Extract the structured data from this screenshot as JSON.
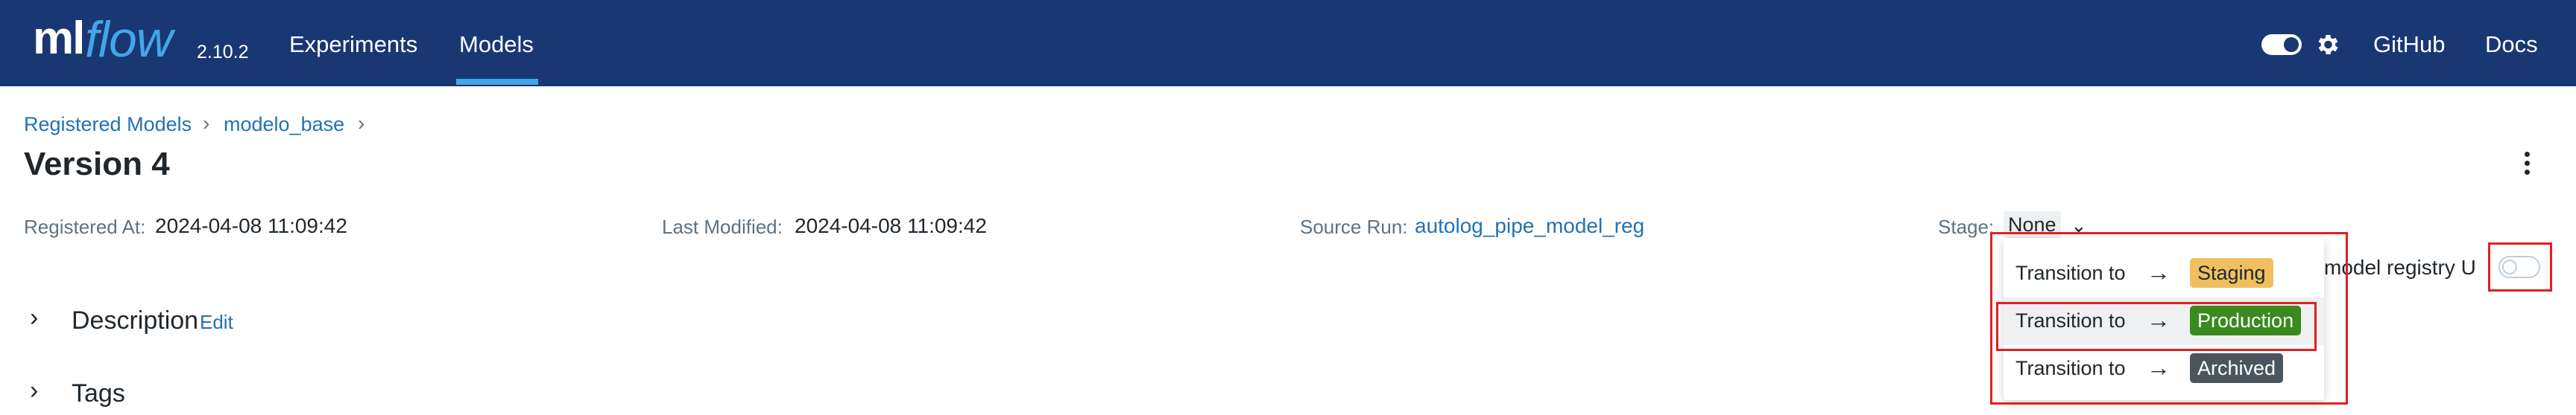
{
  "header": {
    "logo_ml": "ml",
    "logo_flow": "flow",
    "version": "2.10.2",
    "nav": [
      "Experiments",
      "Models"
    ],
    "active_nav": "Models",
    "right_links": [
      "GitHub",
      "Docs"
    ],
    "colors": {
      "bar": "#193773",
      "accent": "#43a5e8"
    }
  },
  "breadcrumb": [
    "Registered Models",
    "modelo_base"
  ],
  "breadcrumb_sep": "›",
  "title": "Version 4",
  "meta": {
    "registered_label": "Registered At:",
    "registered_value": "2024-04-08 11:09:42",
    "modified_label": "Last Modified:",
    "modified_value": "2024-04-08 11:09:42",
    "source_label": "Source Run:",
    "source_value": "autolog_pipe_model_reg",
    "stage_label": "Stage:",
    "stage_value": "None"
  },
  "sections": {
    "description": "Description",
    "edit": "Edit",
    "tags": "Tags"
  },
  "new_ui_text": "w model registry U",
  "stage_menu": {
    "items": [
      {
        "label": "Transition to",
        "arrow": "→",
        "stage": "Staging",
        "color": "#f0c060",
        "text_color": "#1f272d"
      },
      {
        "label": "Transition to",
        "arrow": "→",
        "stage": "Production",
        "color": "#3a8a1e",
        "text_color": "#ffffff"
      },
      {
        "label": "Transition to",
        "arrow": "→",
        "stage": "Archived",
        "color": "#4a5560",
        "text_color": "#ffffff"
      }
    ],
    "highlighted": "Production"
  },
  "icons": [
    "theme-toggle-icon",
    "gear-icon",
    "chevron-right-icon",
    "kebab-menu-icon",
    "chevron-down-icon"
  ]
}
